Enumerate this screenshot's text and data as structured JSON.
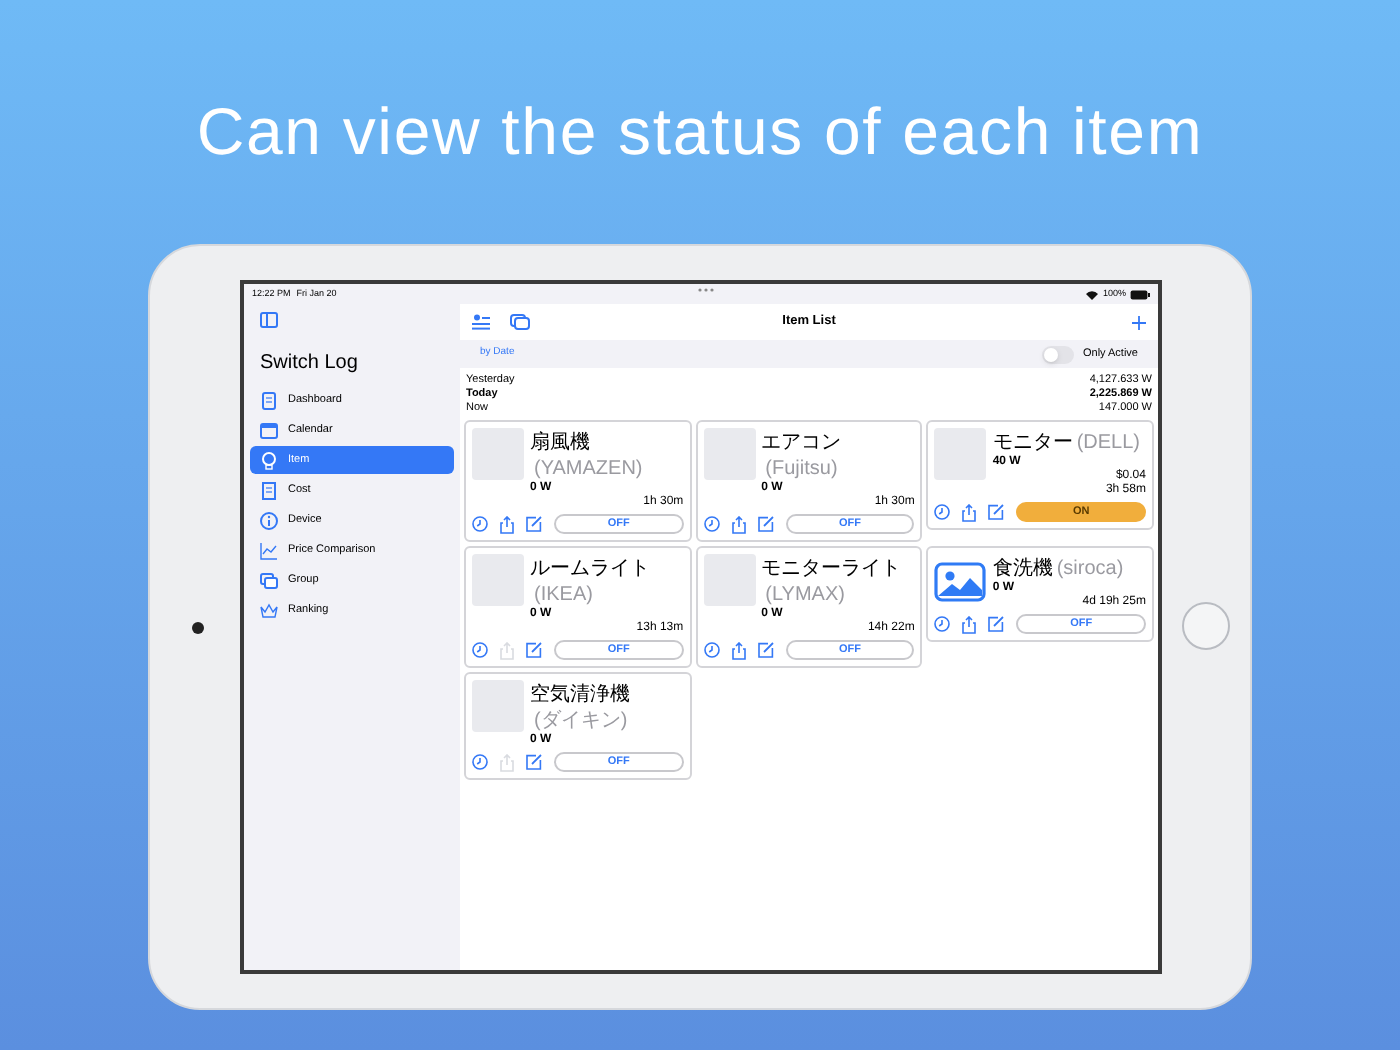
{
  "headline": "Can view the status of each item",
  "status_bar": {
    "time": "12:22 PM",
    "date": "Fri Jan 20",
    "battery": "100%"
  },
  "sidebar": {
    "title": "Switch Log",
    "items": [
      {
        "label": "Dashboard",
        "selected": false
      },
      {
        "label": "Calendar",
        "selected": false
      },
      {
        "label": "Item",
        "selected": true
      },
      {
        "label": "Cost",
        "selected": false
      },
      {
        "label": "Device",
        "selected": false
      },
      {
        "label": "Price Comparison",
        "selected": false
      },
      {
        "label": "Group",
        "selected": false
      },
      {
        "label": "Ranking",
        "selected": false
      }
    ]
  },
  "main": {
    "title": "Item List",
    "filter": "by Date",
    "only_active": {
      "label": "Only Active",
      "on": false
    },
    "summary": [
      {
        "label": "Yesterday",
        "value": "4,127.633 W",
        "emphasized": false
      },
      {
        "label": "Today",
        "value": "2,225.869 W",
        "emphasized": true
      },
      {
        "label": "Now",
        "value": "147.000 W",
        "emphasized": false
      }
    ],
    "items": [
      {
        "name": "扇風機",
        "brand": "(YAMAZEN)",
        "power": "0 W",
        "duration": "1h 30m",
        "switch_label": "OFF",
        "on": false,
        "share_enabled": true,
        "kind": "photo"
      },
      {
        "name": "エアコン",
        "brand": "(Fujitsu)",
        "power": "0 W",
        "duration": "1h 30m",
        "switch_label": "OFF",
        "on": false,
        "share_enabled": true,
        "kind": "photo"
      },
      {
        "name": "モニター",
        "brand": "(DELL)",
        "power": "40 W",
        "cost": "$0.04",
        "duration": "3h 58m",
        "switch_label": "ON",
        "on": true,
        "share_enabled": true,
        "kind": "photo"
      },
      {
        "name": "ルームライト",
        "brand": "(IKEA)",
        "power": "0 W",
        "duration": "13h 13m",
        "switch_label": "OFF",
        "on": false,
        "share_enabled": false,
        "kind": "photo"
      },
      {
        "name": "モニターライト",
        "brand": "(LYMAX)",
        "power": "0 W",
        "duration": "14h 22m",
        "switch_label": "OFF",
        "on": false,
        "share_enabled": true,
        "kind": "photo"
      },
      {
        "name": "食洗機",
        "brand": "(siroca)",
        "power": "0 W",
        "duration": "4d 19h 25m",
        "switch_label": "OFF",
        "on": false,
        "share_enabled": true,
        "kind": "no_image"
      },
      {
        "name": "空気清浄機",
        "brand": "(ダイキン)",
        "power": "0 W",
        "switch_label": "OFF",
        "on": false,
        "share_enabled": false,
        "kind": "photo"
      }
    ]
  }
}
